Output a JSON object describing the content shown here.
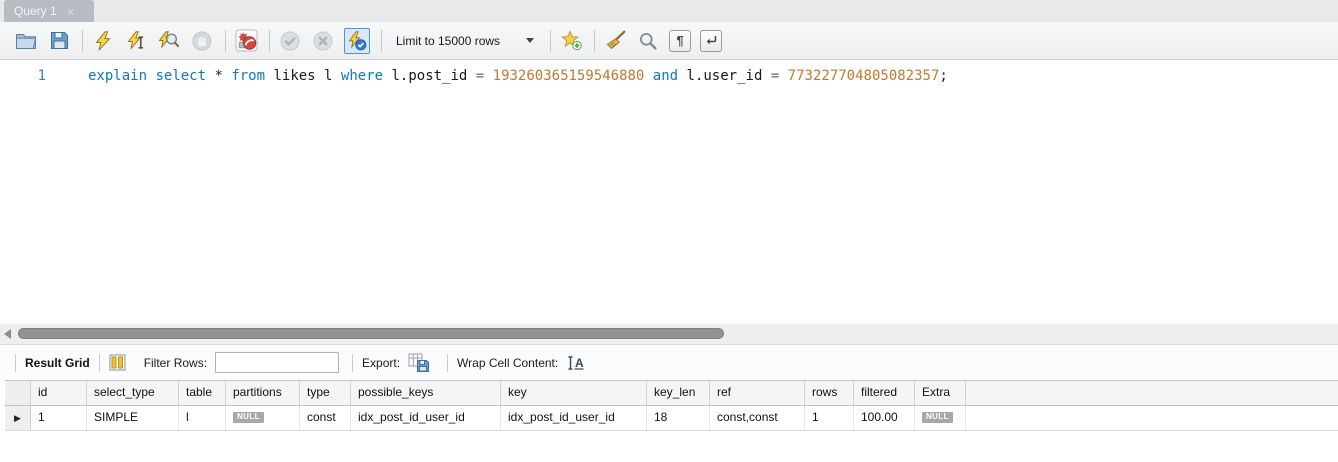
{
  "window": {
    "tab": {
      "title": "Query 1",
      "close_label": "×"
    }
  },
  "toolbar": {
    "limit_dropdown_value": "Limit to 15000 rows",
    "buttons": [
      "open-script",
      "save-script",
      "execute-query",
      "execute-current-statement",
      "explain-query",
      "stop-query",
      "toggle-stop-on-error",
      "commit",
      "rollback",
      "toggle-autocommit",
      "save-snippet",
      "beautify-script",
      "find",
      "show-invisible-characters",
      "toggle-word-wrap"
    ]
  },
  "editor": {
    "line_number": "1",
    "syntax_colors": {
      "keyword": "#0f7ab8",
      "identifier": "#1a1a1a",
      "number": "#c3782e",
      "operator": "#5f6a72",
      "punct": "#1a1a1a"
    },
    "code_tokens": [
      {
        "t": "keyword",
        "v": "explain "
      },
      {
        "t": "keyword",
        "v": "select "
      },
      {
        "t": "identifier",
        "v": "* "
      },
      {
        "t": "keyword",
        "v": "from "
      },
      {
        "t": "identifier",
        "v": "likes l "
      },
      {
        "t": "keyword",
        "v": "where "
      },
      {
        "t": "identifier",
        "v": "l.post_id "
      },
      {
        "t": "operator",
        "v": "= "
      },
      {
        "t": "number",
        "v": "193260365159546880 "
      },
      {
        "t": "keyword",
        "v": "and "
      },
      {
        "t": "identifier",
        "v": "l.user_id "
      },
      {
        "t": "operator",
        "v": "= "
      },
      {
        "t": "number",
        "v": "773227704805082357"
      },
      {
        "t": "punct",
        "v": ";"
      }
    ]
  },
  "result_toolbar": {
    "title": "Result Grid",
    "filter_label": "Filter Rows:",
    "filter_value": "",
    "export_label": "Export:",
    "wrap_label": "Wrap Cell Content:"
  },
  "result_table": {
    "row_marker": "▶",
    "columns": [
      {
        "label": "id",
        "width": 56
      },
      {
        "label": "select_type",
        "width": 92
      },
      {
        "label": "table",
        "width": 47
      },
      {
        "label": "partitions",
        "width": 74
      },
      {
        "label": "type",
        "width": 51
      },
      {
        "label": "possible_keys",
        "width": 150
      },
      {
        "label": "key",
        "width": 146
      },
      {
        "label": "key_len",
        "width": 63
      },
      {
        "label": "ref",
        "width": 95
      },
      {
        "label": "rows",
        "width": 49
      },
      {
        "label": "filtered",
        "width": 61
      },
      {
        "label": "Extra",
        "width": 51
      }
    ],
    "rows": [
      {
        "cells": [
          {
            "text": "1"
          },
          {
            "text": "SIMPLE"
          },
          {
            "text": "l"
          },
          {
            "badge": "NULL"
          },
          {
            "text": "const"
          },
          {
            "text": "idx_post_id_user_id"
          },
          {
            "text": "idx_post_id_user_id"
          },
          {
            "text": "18"
          },
          {
            "text": "const,const"
          },
          {
            "text": "1"
          },
          {
            "text": "100.00"
          },
          {
            "badge": "NULL"
          }
        ]
      }
    ]
  }
}
